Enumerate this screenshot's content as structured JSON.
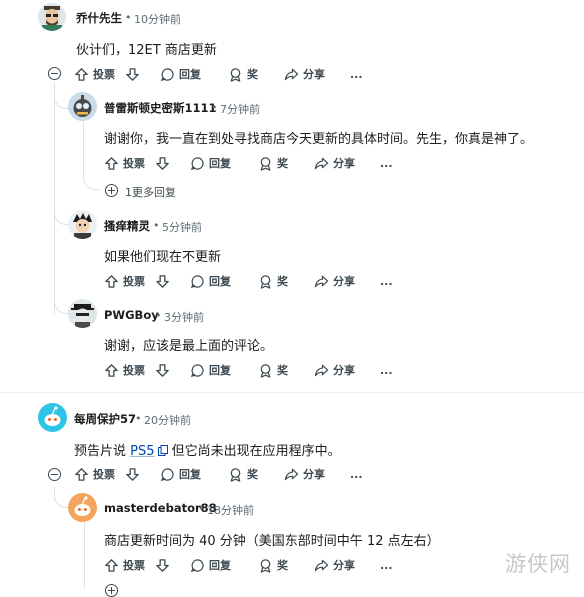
{
  "comments": [
    {
      "author": "乔什先生",
      "time": "10分钟前",
      "text": "伙计们，12ET 商店更新"
    },
    {
      "author": "普雷斯顿史密斯1111",
      "time": "7分钟前",
      "text": "谢谢你，我一直在到处寻找商店今天更新的具体时间。先生，你真是神了。",
      "more_replies": "1更多回复"
    },
    {
      "author": "搔痒精灵",
      "time": "5分钟前",
      "text": "如果他们现在不更新"
    },
    {
      "author": "PWGBoy",
      "time": "3分钟前",
      "text": "谢谢，应该是最上面的评论。"
    },
    {
      "author": "每周保护57",
      "time": "20分钟前",
      "text_before": "预告片说 ",
      "link": "PS5",
      "text_after": " 但它尚未出现在应用程序中。"
    },
    {
      "author": "masterdebator88",
      "time": "18分钟前",
      "text": "商店更新时间为 40 分钟（美国东部时间中午 12 点左右）"
    }
  ],
  "actions": {
    "upvote": "投票",
    "reply": "回复",
    "award": "奖",
    "share": "分享",
    "more": "..."
  },
  "separator": "•",
  "watermark": "游侠网",
  "colors": {
    "avatar_teal": "#2ec4e6",
    "avatar_orange": "#f3a55f",
    "link": "#0045ac"
  }
}
